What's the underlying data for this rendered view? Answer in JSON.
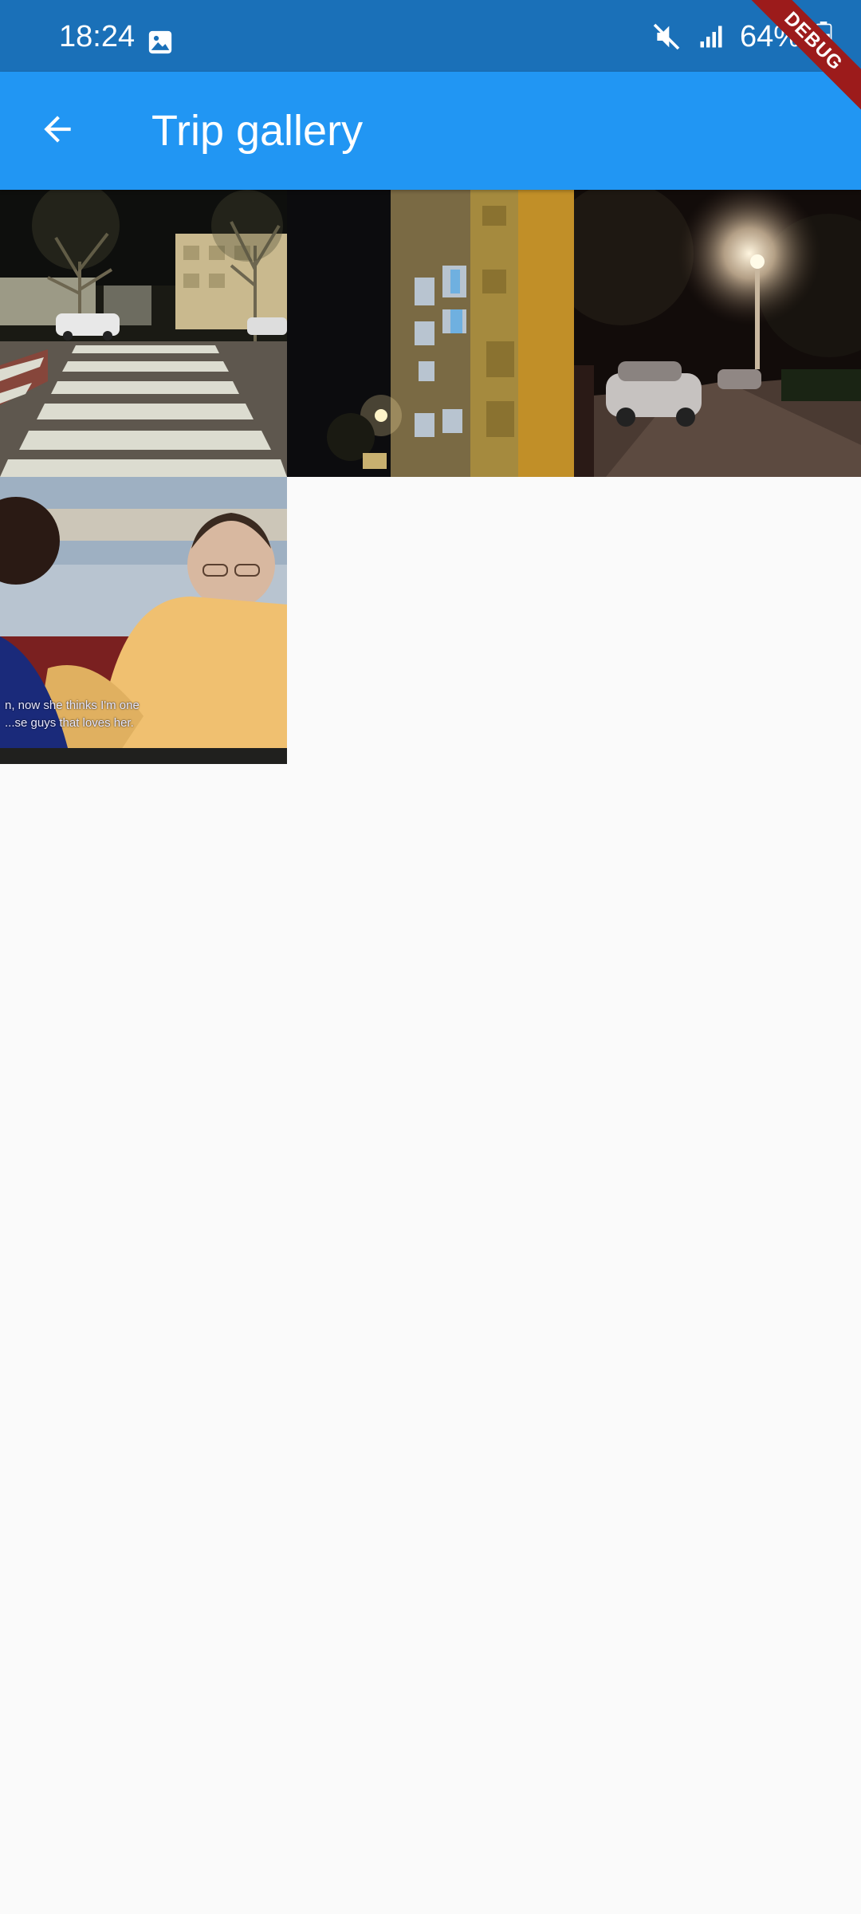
{
  "status_bar": {
    "time": "18:24",
    "battery": "64%",
    "icons": [
      "gallery-notification-icon",
      "mute-icon",
      "signal-icon",
      "battery-icon"
    ]
  },
  "app_bar": {
    "title": "Trip gallery",
    "back_icon": "arrow-back-icon",
    "color": "#2196f3"
  },
  "debug_banner": "DEBUG",
  "gallery": {
    "photos": [
      {
        "description_icon": "photo-crosswalk-night"
      },
      {
        "description_icon": "photo-building-night"
      },
      {
        "description_icon": "photo-street-lamp-night"
      },
      {
        "description_icon": "photo-tv-screenshot",
        "caption_lines": [
          "n, now she thinks I'm one",
          "...se guys that loves her."
        ]
      }
    ]
  }
}
